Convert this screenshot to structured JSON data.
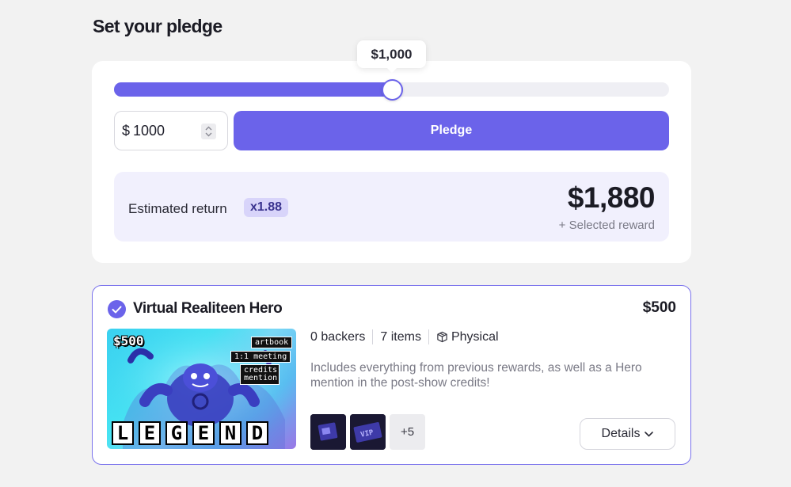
{
  "page": {
    "title": "Set your pledge"
  },
  "slider": {
    "tooltip": "$1,000",
    "fill_fraction": 0.5
  },
  "amount_input": {
    "currency": "$",
    "value": "1000"
  },
  "pledge_button": {
    "label": "Pledge"
  },
  "estimate": {
    "label": "Estimated return",
    "multiplier": "x1.88",
    "amount": "$1,880",
    "sub": "+ Selected reward"
  },
  "reward": {
    "title": "Virtual Realiteen Hero",
    "price": "$500",
    "backers": "0 backers",
    "items": "7 items",
    "type": "Physical",
    "description": "Includes everything from previous rewards, as well as a Hero mention in the post-show credits!",
    "more_items": "+5",
    "details_label": "Details",
    "image": {
      "price_tag": "$500",
      "tags": [
        "artbook",
        "1:1 meeting",
        "credits mention"
      ],
      "banner": [
        "L",
        "E",
        "G",
        "E",
        "N",
        "D"
      ]
    },
    "item_thumbs": [
      "gift-card-icon",
      "vip-ticket-icon"
    ]
  },
  "colors": {
    "accent": "#6b63ea",
    "accent_light": "#f1f0fd",
    "badge": "#d8d4fa"
  }
}
